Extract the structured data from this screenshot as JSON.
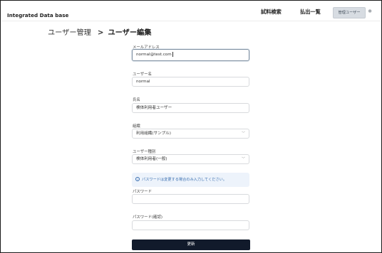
{
  "app": {
    "title": "Integrated Data base"
  },
  "nav": {
    "search_label": "試料検索",
    "checkout_label": "払出一覧",
    "admin_label": "管理ユーザー",
    "settings_icon": "gear-icon"
  },
  "breadcrumb": {
    "parent": "ユーザー管理",
    "separator": ">",
    "current": "ユーザー編集"
  },
  "form": {
    "email": {
      "label": "メールアドレス",
      "value": "normal@test.com"
    },
    "username": {
      "label": "ユーザー名",
      "value": "normal"
    },
    "fullname": {
      "label": "氏名",
      "value": "検体利用者ユーザー"
    },
    "organization": {
      "label": "組織",
      "value": "利用組織(サンプル)"
    },
    "user_type": {
      "label": "ユーザー種別",
      "value": "検体利用者(一般)"
    },
    "password_notice": "パスワードは変更する場合のみ入力してください。",
    "password": {
      "label": "パスワード",
      "value": ""
    },
    "password_confirm": {
      "label": "パスワード(確認)",
      "value": ""
    },
    "submit_label": "更新"
  },
  "colors": {
    "primary_button": "#111a2b",
    "info_background": "#edf3fb",
    "info_text": "#3a6fb0",
    "admin_badge": "#d7dce2"
  }
}
